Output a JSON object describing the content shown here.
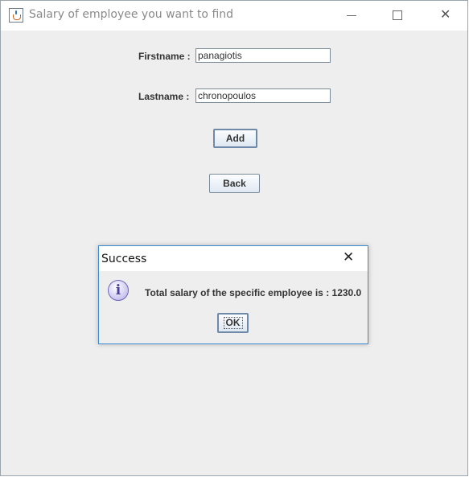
{
  "window": {
    "title": "Salary of employee you want to find"
  },
  "form": {
    "firstname_label": "Firstname :",
    "firstname_value": "panagiotis",
    "lastname_label": "Lastname :",
    "lastname_value": "chronopoulos",
    "add_label": "Add",
    "back_label": "Back"
  },
  "dialog": {
    "title": "Success",
    "message": "Total salary of the specific employee is : 1230.0",
    "ok_label": "OK",
    "info_glyph": "i"
  },
  "icons": [
    "java-app-icon",
    "minimize-icon",
    "maximize-icon",
    "close-icon",
    "info-icon",
    "dialog-close-icon"
  ]
}
